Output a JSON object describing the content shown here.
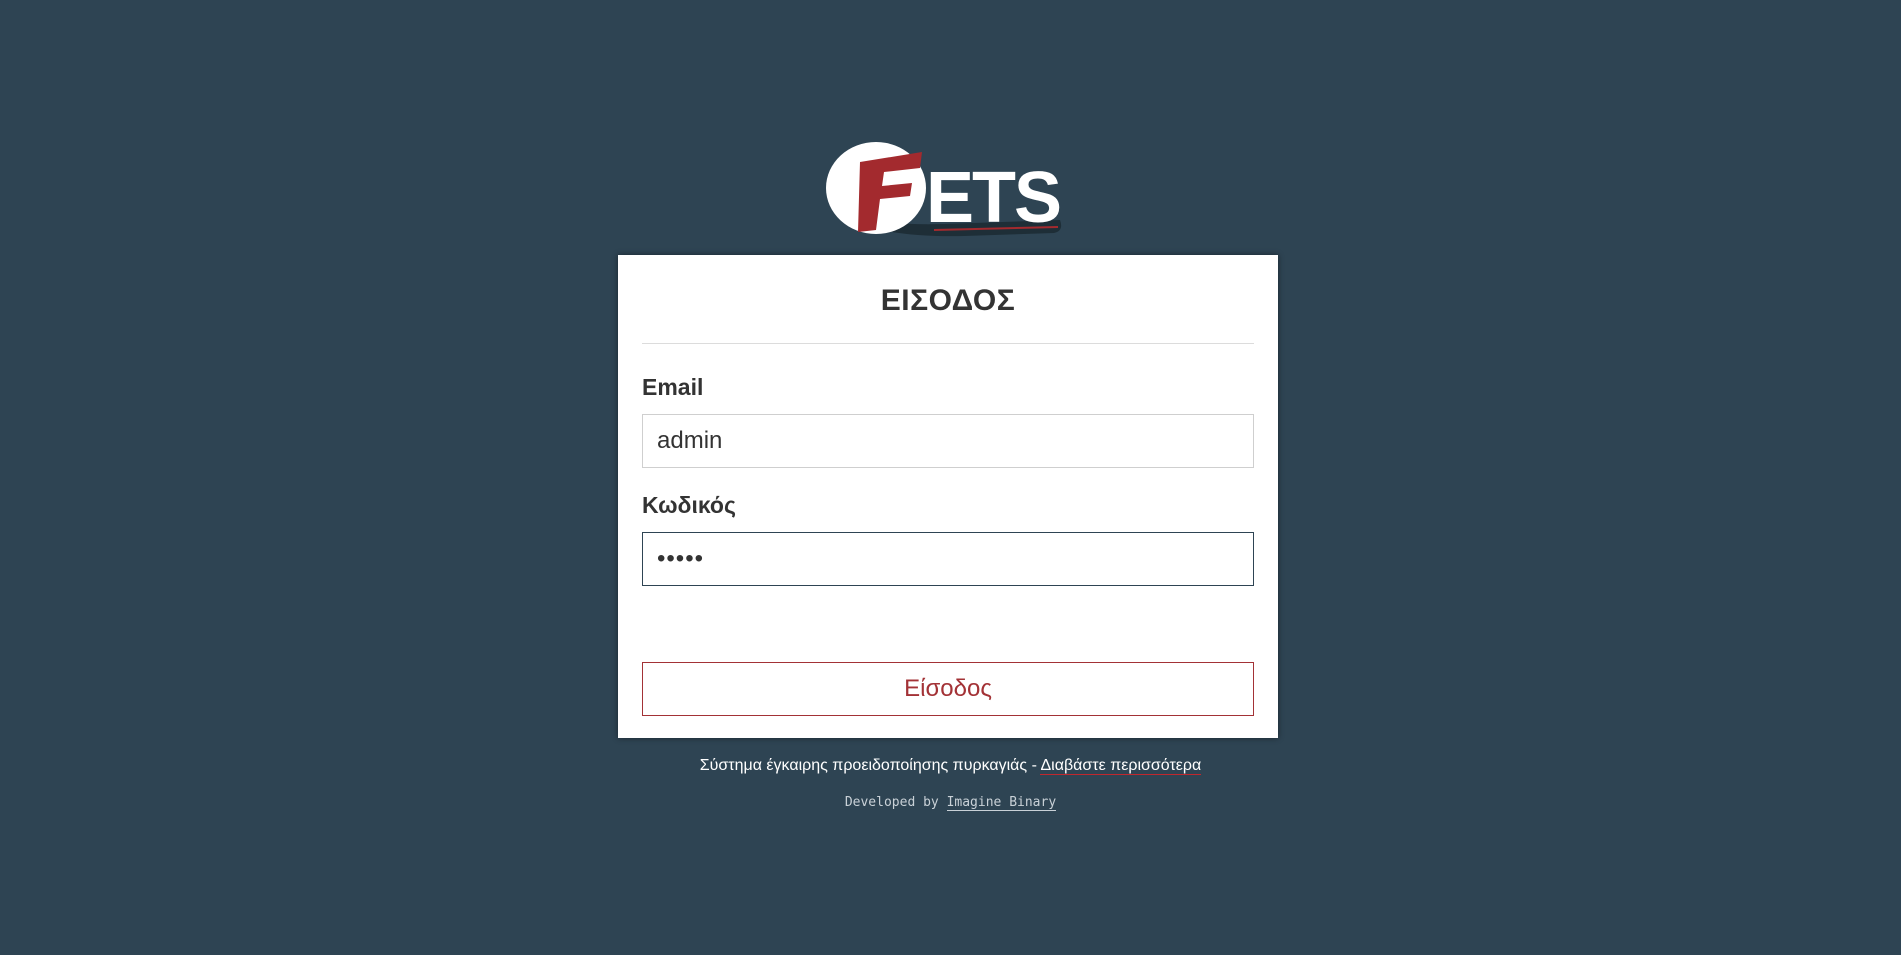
{
  "brand": {
    "logo_text": "FETS",
    "logo_colors": {
      "f_letter": "#a32a2e",
      "ellipse": "#ffffff",
      "letters": "#ffffff",
      "shadow": "#1b2a33",
      "underline": "#a32a2e"
    }
  },
  "login": {
    "title": "ΕΙΣΟΔΟΣ",
    "email_label": "Email",
    "email_value": "admin",
    "password_label": "Κωδικός",
    "password_value": "•••••",
    "submit_label": "Είσοδος"
  },
  "footer": {
    "tagline": "Σύστημα έγκαιρης προειδοποίησης πυρκαγιάς - ",
    "read_more": "Διαβάστε περισσότερα",
    "developed_by": "Developed by ",
    "developer": "Imagine Binary"
  },
  "colors": {
    "background": "#2e4453",
    "accent": "#a33236",
    "card": "#ffffff"
  }
}
